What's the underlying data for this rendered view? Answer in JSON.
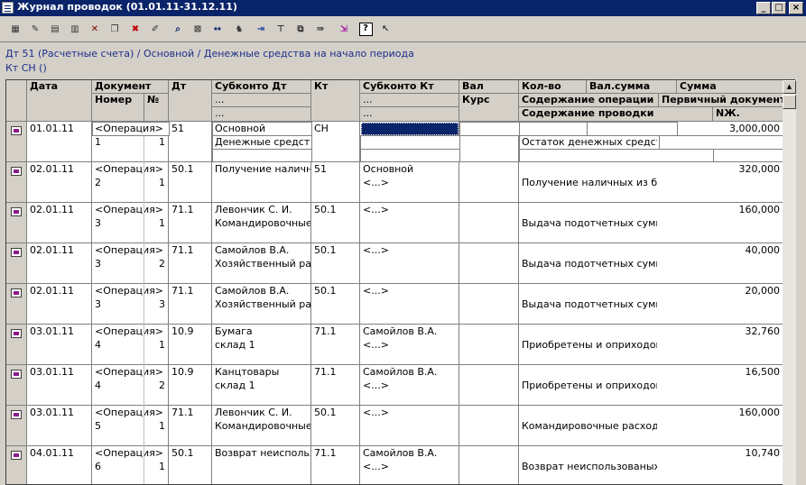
{
  "window": {
    "title": "Журнал проводок (01.01.11-31.12.11)",
    "min_glyph": "_",
    "max_glyph": "□",
    "close_glyph": "×"
  },
  "toolbar": {
    "icons": [
      "new-entry-icon",
      "copy-entry-icon",
      "document-icon",
      "add-row-icon",
      "delete-icon",
      "copy-icon",
      "remove-icon",
      "edit-doc-icon",
      "find-icon",
      "filter-icon",
      "interval-icon",
      "tree-icon",
      "move-in-icon",
      "move-up-icon",
      "move-copy-icon",
      "move-right-icon",
      "export-icon",
      "help-icon",
      "whats-this-icon"
    ]
  },
  "info": {
    "line1": "Дт 51 (Расчетные счета) / Основной / Денежные средства на начало периода",
    "line2": "Кт СН ()"
  },
  "columns": {
    "date": "Дата",
    "document": "Документ",
    "number": "Номер",
    "no": "№",
    "dt": "Дт",
    "subkonto_dt": "Субконто Дт",
    "subkonto_dt_2": "...",
    "subkonto_dt_3": "...",
    "kt": "Кт",
    "subkonto_kt": "Субконто Кт",
    "subkonto_kt_2": "...",
    "subkonto_kt_3": "...",
    "val": "Вал",
    "kurs": "Курс",
    "qty": "Кол-во",
    "val_sum": "Вал.сумма",
    "sum": "Сумма",
    "op_content": "Содержание операции",
    "primary_doc": "Первичный документ",
    "entry_content": "Содержание проводки",
    "nzh": "NЖ."
  },
  "rows": [
    {
      "date": "01.01.11",
      "doc": "<Операция>",
      "number": "1",
      "no": "1",
      "dt": "51",
      "sub_dt1": "Основной",
      "sub_dt2": "Денежные средства",
      "kt": "СН",
      "sub_kt1": "",
      "sub_kt2": "",
      "content": "Остаток денежных средств",
      "sum": "3,000,000"
    },
    {
      "date": "02.01.11",
      "doc": "<Операция>",
      "number": "2",
      "no": "1",
      "dt": "50.1",
      "sub_dt1": "Получение наличных",
      "sub_dt2": "",
      "kt": "51",
      "sub_kt1": "Основной",
      "sub_kt2": "<...>",
      "content": "Получение наличных из банк",
      "sum": "320,000"
    },
    {
      "date": "02.01.11",
      "doc": "<Операция>",
      "number": "3",
      "no": "1",
      "dt": "71.1",
      "sub_dt1": "Левончик С. И.",
      "sub_dt2": "Командировочные р",
      "kt": "50.1",
      "sub_kt1": "<...>",
      "sub_kt2": "",
      "content": "Выдача подотчетных сумм",
      "sum": "160,000"
    },
    {
      "date": "02.01.11",
      "doc": "<Операция>",
      "number": "3",
      "no": "2",
      "dt": "71.1",
      "sub_dt1": "Самойлов В.А.",
      "sub_dt2": "Хозяйственный рас",
      "kt": "50.1",
      "sub_kt1": "<...>",
      "sub_kt2": "",
      "content": "Выдача подотчетных сумм",
      "sum": "40,000"
    },
    {
      "date": "02.01.11",
      "doc": "<Операция>",
      "number": "3",
      "no": "3",
      "dt": "71.1",
      "sub_dt1": "Самойлов В.А.",
      "sub_dt2": "Хозяйственный рас",
      "kt": "50.1",
      "sub_kt1": "<...>",
      "sub_kt2": "",
      "content": "Выдача подотчетных сумм",
      "sum": "20,000"
    },
    {
      "date": "03.01.11",
      "doc": "<Операция>",
      "number": "4",
      "no": "1",
      "dt": "10.9",
      "sub_dt1": "Бумага",
      "sub_dt2": "склад 1",
      "kt": "71.1",
      "sub_kt1": "Самойлов В.А.",
      "sub_kt2": "<...>",
      "content": "Приобретены и оприходовані",
      "sum": "32,760"
    },
    {
      "date": "03.01.11",
      "doc": "<Операция>",
      "number": "4",
      "no": "2",
      "dt": "10.9",
      "sub_dt1": "Канцтовары",
      "sub_dt2": "склад 1",
      "kt": "71.1",
      "sub_kt1": "Самойлов В.А.",
      "sub_kt2": "<...>",
      "content": "Приобретены и оприходовані",
      "sum": "16,500"
    },
    {
      "date": "03.01.11",
      "doc": "<Операция>",
      "number": "5",
      "no": "1",
      "dt": "71.1",
      "sub_dt1": "Левончик С. И.",
      "sub_dt2": "Командировочные р",
      "kt": "50.1",
      "sub_kt1": "<...>",
      "sub_kt2": "",
      "content": "Командировочные расходы",
      "sum": "160,000"
    },
    {
      "date": "04.01.11",
      "doc": "<Операция>",
      "number": "6",
      "no": "1",
      "dt": "50.1",
      "sub_dt1": "Возврат неиспользо",
      "sub_dt2": "",
      "kt": "71.1",
      "sub_kt1": "Самойлов В.А.",
      "sub_kt2": "<...>",
      "content": "Возврат неиспользованых пс",
      "sum": "10,740"
    }
  ]
}
